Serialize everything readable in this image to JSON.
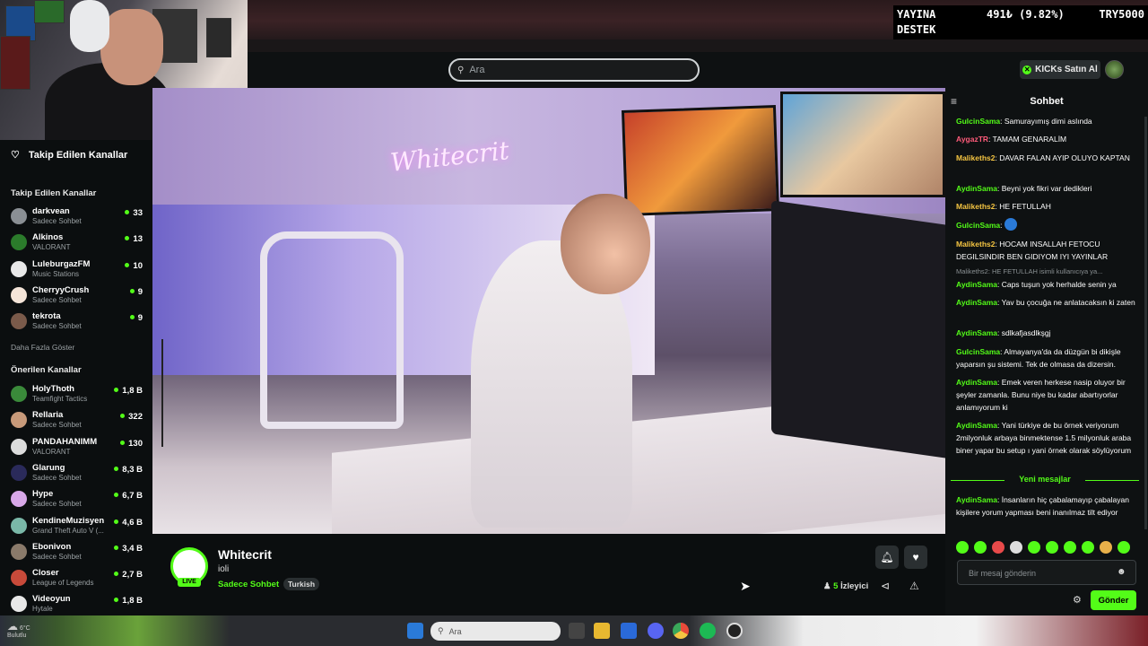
{
  "overlay": {
    "line1": "YAYINA",
    "line2": "DESTEK",
    "amount": "491₺ (9.82%)",
    "goal": "TRY5000"
  },
  "nav": {
    "search_placeholder": "Ara",
    "kicks_label": "KICKs Satın Al"
  },
  "sidebar": {
    "header": "Takip Edilen Kanallar",
    "followed_title": "Takip Edilen Kanallar",
    "followed": [
      {
        "name": "darkvean",
        "sub": "Sadece Sohbet",
        "count": "33",
        "color": "#8a8f94"
      },
      {
        "name": "Alkinos",
        "sub": "VALORANT",
        "count": "13",
        "color": "#2b7b2b"
      },
      {
        "name": "LuleburgazFM",
        "sub": "Music Stations",
        "count": "10",
        "color": "#e8e8e8"
      },
      {
        "name": "CherryyCrush",
        "sub": "Sadece Sohbet",
        "count": "9",
        "color": "#f4e4d8"
      },
      {
        "name": "tekrota",
        "sub": "Sadece Sohbet",
        "count": "9",
        "color": "#7a5a4a"
      }
    ],
    "show_more": "Daha Fazla Göster",
    "suggested_title": "Önerilen Kanallar",
    "suggested": [
      {
        "name": "HolyThoth",
        "sub": "Teamfight Tactics",
        "count": "1,8 B",
        "color": "#3a8a3a"
      },
      {
        "name": "Rellaria",
        "sub": "Sadece Sohbet",
        "count": "322",
        "color": "#c89a7a"
      },
      {
        "name": "PANDAHANIMM",
        "sub": "VALORANT",
        "count": "130",
        "color": "#dcdcdc"
      },
      {
        "name": "Glarung",
        "sub": "Sadece Sohbet",
        "count": "8,3 B",
        "color": "#2a2a5a"
      },
      {
        "name": "Hype",
        "sub": "Sadece Sohbet",
        "count": "6,7 B",
        "color": "#d8a8e8"
      },
      {
        "name": "KendineMuzisyen",
        "sub": "Grand Theft Auto V (...",
        "count": "4,6 B",
        "color": "#7ab8a8"
      },
      {
        "name": "Ebonivon",
        "sub": "Sadece Sohbet",
        "count": "3,4 B",
        "color": "#8a7a6a"
      },
      {
        "name": "Closer",
        "sub": "League of Legends",
        "count": "2,7 B",
        "color": "#c84a3a"
      },
      {
        "name": "Videoyun",
        "sub": "Hytale",
        "count": "1,8 B",
        "color": "#e8e8e8"
      }
    ]
  },
  "video": {
    "neon_sign": "Whitecrit"
  },
  "stream": {
    "live_badge": "LIVE",
    "channel": "Whitecrit",
    "title": "ioli",
    "category": "Sadece Sohbet",
    "tag": "Turkish",
    "viewers_count": "5",
    "viewers_label": "İzleyici"
  },
  "chat": {
    "title": "Sohbet",
    "messages": [
      {
        "user": "GulcinSama",
        "color": "#53fc18",
        "text": "Samurayımış dimi aslında"
      },
      {
        "user": "AygazTR",
        "color": "#ff5b7a",
        "text": "TAMAM GENARALİM"
      },
      {
        "user": "Malikeths2",
        "color": "#f5c542",
        "text": "DAVAR FALAN AYIP OLUYO KAPTAN"
      },
      {
        "user": "AydinSama",
        "color": "#53fc18",
        "text": "Beyni yok fikri var dedikleri"
      },
      {
        "user": "Malikeths2",
        "color": "#f5c542",
        "text": "HE FETULLAH"
      },
      {
        "user": "GulcinSama",
        "color": "#53fc18",
        "text": ""
      },
      {
        "user": "Malikeths2",
        "color": "#f5c542",
        "text": "HOCAM INSALLAH FETOCU DEGILSINDIR BEN GIDIYOM IYI YAYINLAR"
      },
      {
        "user": "AydinSama",
        "color": "#53fc18",
        "text": "Caps tuşun yok herhalde senin ya"
      },
      {
        "user": "AydinSama",
        "color": "#53fc18",
        "text": "Yav bu çocuğa ne anlatacaksın ki zaten"
      },
      {
        "user": "AydinSama",
        "color": "#53fc18",
        "text": "sdlkafjasdlkşgj"
      },
      {
        "user": "GulcinSama",
        "color": "#53fc18",
        "text": "Almayanya'da da düzgün bi dikişle yaparsın şu sistemi. Tek de olmasa da dizersin."
      },
      {
        "user": "AydinSama",
        "color": "#53fc18",
        "text": "Emek veren herkese nasip oluyor bir şeyler zamanla. Bunu niye bu kadar abartıyorlar anlamıyorum ki"
      },
      {
        "user": "AydinSama",
        "color": "#53fc18",
        "text": "Yani türkiye de bu örnek veriyorum 2milyonluk arbaya binmektense 1.5 milyonluk araba biner yapar bu setup ı yani örnek olarak söylüyorum"
      },
      {
        "user": "AydinSama",
        "color": "#53fc18",
        "text": "İnsanların hiç çabalamayıp çabalayan kişilere yorum yapması beni inanılmaz tilt ediyor"
      }
    ],
    "reply_preview": "Malikeths2: HE FETULLAH isimli kullanıcıya ya...",
    "new_messages": "Yeni mesajlar",
    "input_placeholder": "Bir mesaj gönderin",
    "send_label": "Gönder"
  },
  "taskbar": {
    "search_placeholder": "Ara",
    "weather_temp": "6°C",
    "weather_desc": "Bulutlu"
  }
}
